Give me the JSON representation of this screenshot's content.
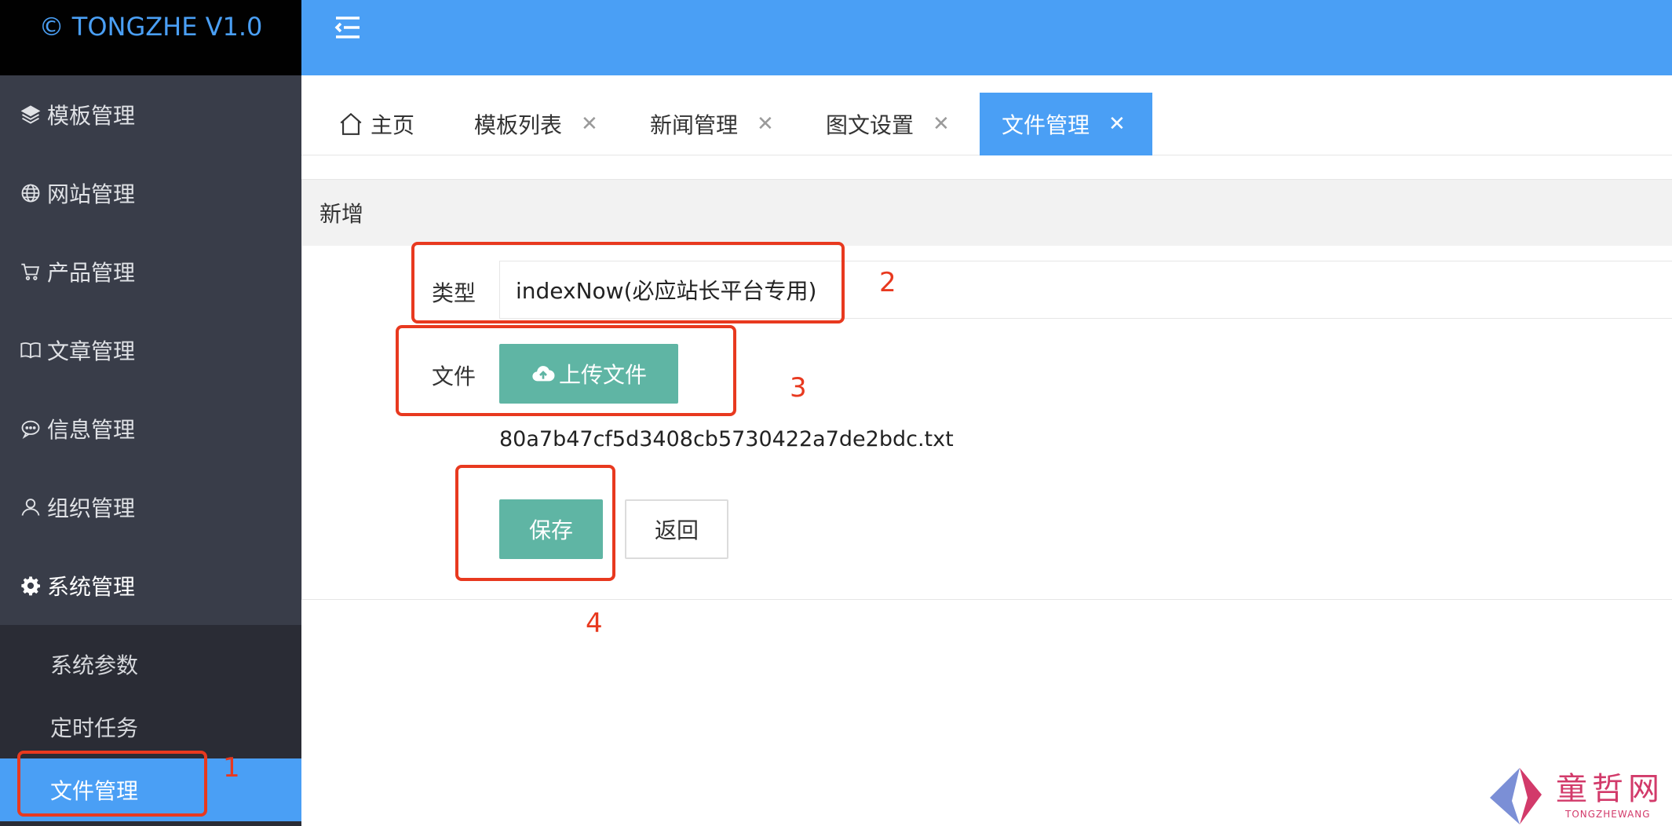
{
  "app": {
    "logo": "© TONGZHE V1.0"
  },
  "sidebar": {
    "items": [
      {
        "label": "模板管理",
        "icon": "layers-icon"
      },
      {
        "label": "网站管理",
        "icon": "globe-icon"
      },
      {
        "label": "产品管理",
        "icon": "cart-icon"
      },
      {
        "label": "文章管理",
        "icon": "book-icon"
      },
      {
        "label": "信息管理",
        "icon": "chat-icon"
      },
      {
        "label": "组织管理",
        "icon": "user-icon"
      },
      {
        "label": "系统管理",
        "icon": "gear-icon"
      }
    ],
    "submenu": [
      {
        "label": "系统参数"
      },
      {
        "label": "定时任务"
      },
      {
        "label": "文件管理"
      }
    ]
  },
  "tabs": [
    {
      "label": "主页",
      "closable": false
    },
    {
      "label": "模板列表",
      "closable": true
    },
    {
      "label": "新闻管理",
      "closable": true
    },
    {
      "label": "图文设置",
      "closable": true
    },
    {
      "label": "文件管理",
      "closable": true,
      "active": true
    }
  ],
  "tab_close_glyph": "✕",
  "card": {
    "title": "新增"
  },
  "form": {
    "type_label": "类型",
    "type_value": "indexNow(必应站长平台专用)",
    "file_label": "文件",
    "upload_label": "上传文件",
    "file_name": "80a7b47cf5d3408cb5730422a7de2bdc.txt",
    "save_label": "保存",
    "back_label": "返回"
  },
  "annotations": [
    "1",
    "2",
    "3",
    "4"
  ],
  "watermark": {
    "text": "童哲网",
    "sub": "TONGZHEWANG"
  },
  "colors": {
    "header": "#4a9ff5",
    "sidebar": "#393d49",
    "primary_button": "#5fb5a4",
    "annotation": "#e8391f"
  }
}
